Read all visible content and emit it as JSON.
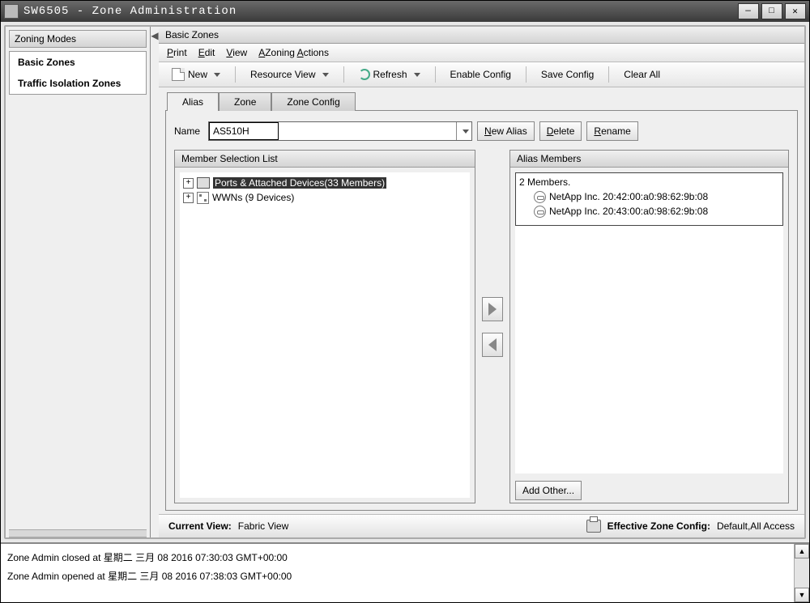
{
  "window": {
    "title": "SW6505 - Zone Administration"
  },
  "sidebar": {
    "header": "Zoning Modes",
    "items": [
      {
        "label": "Basic Zones"
      },
      {
        "label": "Traffic Isolation Zones"
      }
    ]
  },
  "panel": {
    "title": "Basic Zones"
  },
  "menubar": {
    "print": "Print",
    "edit": "Edit",
    "view": "View",
    "zoning_actions": "Zoning Actions"
  },
  "toolbar": {
    "new": "New",
    "resource_view": "Resource View",
    "refresh": "Refresh",
    "enable_config": "Enable Config",
    "save_config": "Save Config",
    "clear_all": "Clear All"
  },
  "tabs": {
    "alias": "Alias",
    "zone": "Zone",
    "zone_config": "Zone Config"
  },
  "alias_page": {
    "name_label": "Name",
    "name_value": "AS510H",
    "new_alias": "New Alias",
    "delete": "Delete",
    "rename": "Rename",
    "member_selection_header": "Member Selection List",
    "tree": {
      "ports": "Ports & Attached Devices(33 Members)",
      "wwns": "WWNs (9 Devices)"
    },
    "alias_members_header": "Alias Members",
    "members_count": "2 Members.",
    "members": [
      "NetApp Inc. 20:42:00:a0:98:62:9b:08",
      "NetApp Inc. 20:43:00:a0:98:62:9b:08"
    ],
    "add_other": "Add Other..."
  },
  "statusbar": {
    "current_view_label": "Current View:",
    "current_view_value": "Fabric View",
    "effective_label": "Effective Zone Config:",
    "effective_value": "Default,All Access"
  },
  "log": {
    "line1": "Zone Admin closed at 星期二 三月 08 2016 07:30:03 GMT+00:00",
    "line2": "Zone Admin opened at 星期二 三月 08 2016 07:38:03 GMT+00:00"
  }
}
